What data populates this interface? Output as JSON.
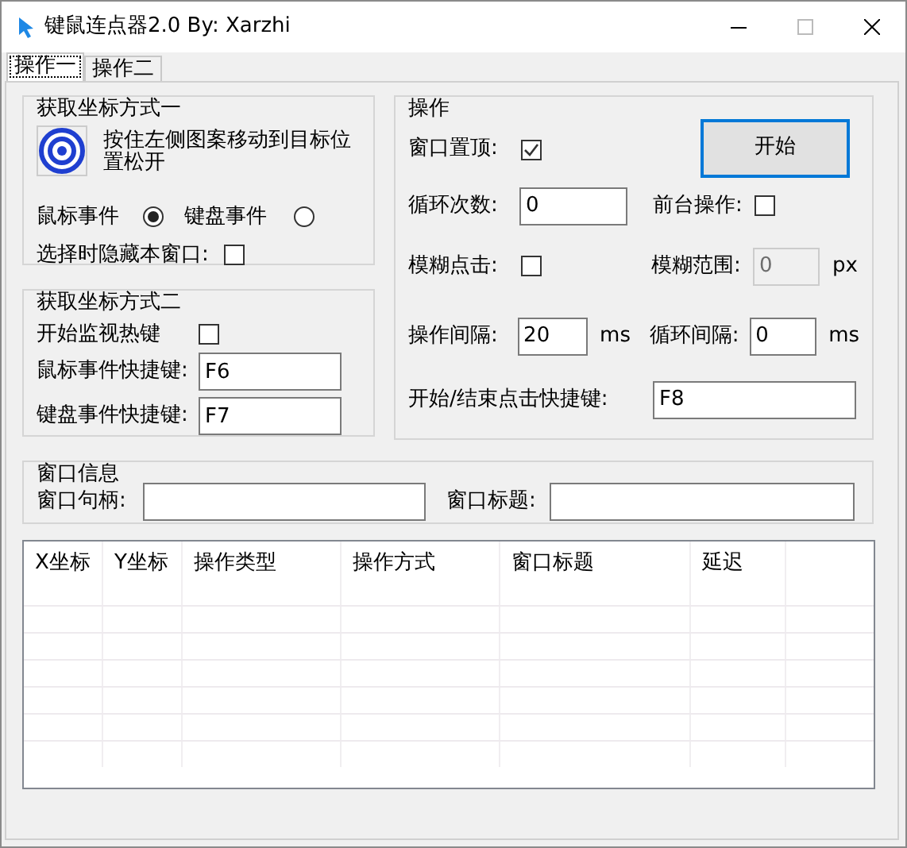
{
  "window": {
    "title": "键鼠连点器2.0 By:  Xarzhi"
  },
  "tabs": [
    {
      "label": "操作一",
      "selected": true
    },
    {
      "label": "操作二",
      "selected": false
    }
  ],
  "pick_method_one": {
    "title": "获取坐标方式一",
    "hint": "按住左侧图案移动到目标位置松开",
    "radios": [
      {
        "label": "鼠标事件",
        "selected": true
      },
      {
        "label": "键盘事件",
        "selected": false
      }
    ],
    "hide_window": {
      "label": "选择时隐藏本窗口:",
      "checked": false
    }
  },
  "pick_method_two": {
    "title": "获取坐标方式二",
    "monitor_hotkey": {
      "label": "开始监视热键",
      "checked": false
    },
    "fields": [
      {
        "label": "鼠标事件快捷键:",
        "value": "F6"
      },
      {
        "label": "键盘事件快捷键:",
        "value": "F7"
      }
    ]
  },
  "operation": {
    "title": "操作",
    "start_button": "开始",
    "topmost": {
      "label": "窗口置顶:",
      "checked": true
    },
    "loop_count": {
      "label": "循环次数:",
      "value": "0"
    },
    "foreground": {
      "label": "前台操作:",
      "checked": false
    },
    "fuzzy_click": {
      "label": "模糊点击:",
      "checked": false
    },
    "fuzzy_range": {
      "label": "模糊范围:",
      "value": "0",
      "disabled": true,
      "unit": "px"
    },
    "op_interval": {
      "label": "操作间隔:",
      "value": "20",
      "unit": "ms"
    },
    "loop_interval": {
      "label": "循环间隔:",
      "value": "0",
      "unit": "ms"
    },
    "hotkey": {
      "label": "开始/结束点击快捷键:",
      "value": "F8"
    }
  },
  "window_info": {
    "title": "窗口信息",
    "fields": [
      {
        "label": "窗口句柄:"
      },
      {
        "label": "窗口标题:"
      }
    ]
  },
  "table": {
    "columns": [
      "X坐标",
      "Y坐标",
      "操作类型",
      "操作方式",
      "窗口标题",
      "延迟"
    ]
  }
}
